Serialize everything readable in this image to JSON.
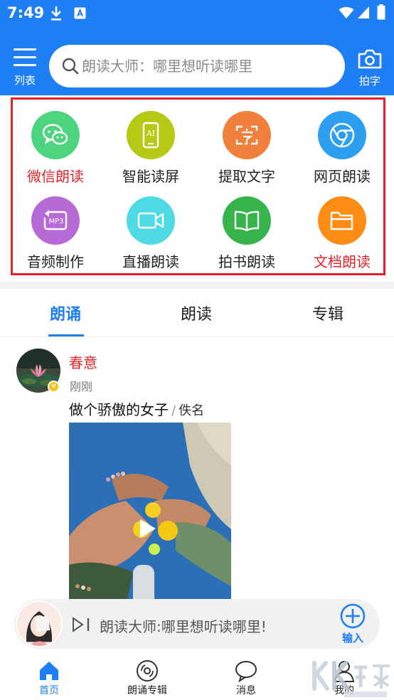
{
  "status_bar": {
    "time": "7:49"
  },
  "header": {
    "menu_label": "列表",
    "search_placeholder": "朗读大师：哪里想听读哪里",
    "camera_label": "拍字"
  },
  "features": [
    {
      "label": "微信朗读",
      "icon": "wechat-icon",
      "color": "#4cd47f",
      "highlight": true
    },
    {
      "label": "智能读屏",
      "icon": "ai-phone-icon",
      "color": "#b6c914",
      "highlight": false
    },
    {
      "label": "提取文字",
      "icon": "extract-text-icon",
      "color": "#f0803c",
      "highlight": false
    },
    {
      "label": "网页朗读",
      "icon": "browser-icon",
      "color": "#2e9ef0",
      "highlight": false
    },
    {
      "label": "音频制作",
      "icon": "mp3-icon",
      "color": "#b76ad6",
      "highlight": false
    },
    {
      "label": "直播朗读",
      "icon": "video-camera-icon",
      "color": "#4fdbe6",
      "highlight": false
    },
    {
      "label": "拍书朗读",
      "icon": "book-icon",
      "color": "#36b34a",
      "highlight": false
    },
    {
      "label": "文档朗读",
      "icon": "folder-icon",
      "color": "#fc8c12",
      "highlight": true
    }
  ],
  "tabs": [
    {
      "label": "朗诵",
      "active": true
    },
    {
      "label": "朗读",
      "active": false
    },
    {
      "label": "专辑",
      "active": false
    }
  ],
  "post": {
    "author": "春意",
    "time": "刚刚",
    "title": "做个骄傲的女子",
    "separator": "/",
    "by": "佚名",
    "badge": "v"
  },
  "player": {
    "text": "朗读大师:哪里想听读哪里!",
    "input_label": "输入"
  },
  "bottom_nav": [
    {
      "label": "首页",
      "icon": "home-icon",
      "active": true
    },
    {
      "label": "朗诵专辑",
      "icon": "disc-icon",
      "active": false
    },
    {
      "label": "消息",
      "icon": "chat-bubble-icon",
      "active": false
    },
    {
      "label": "我的",
      "icon": "person-icon",
      "active": false
    }
  ],
  "colors": {
    "brand": "#1e7ff5",
    "highlight_red": "#e6232a"
  }
}
